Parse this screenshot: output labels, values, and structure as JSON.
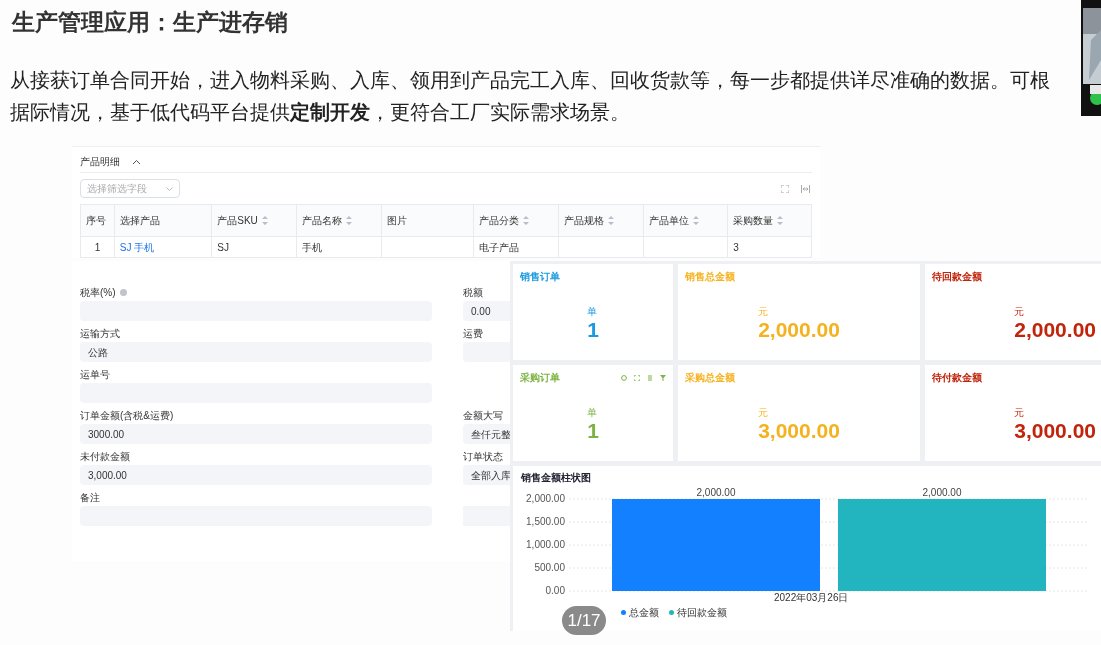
{
  "slide": {
    "title": "生产管理应用：生产进存销",
    "paragraph": "从接获订单合同开始，进入物料采购、入库、领用到产品完工入库、回收货款等，每一步都提供详尽准确的数据。可根据际情况，基于低代码平台提供**定制开发**，更符合工厂实际需求场景。",
    "counter": "1/17"
  },
  "product_section": {
    "title": "产品明细",
    "expanded": true,
    "filter_placeholder": "选择筛选字段",
    "columns": [
      {
        "label": "序号",
        "sortable": false
      },
      {
        "label": "选择产品",
        "sortable": false
      },
      {
        "label": "产品SKU",
        "sortable": true
      },
      {
        "label": "产品名称",
        "sortable": true
      },
      {
        "label": "图片",
        "sortable": false
      },
      {
        "label": "产品分类",
        "sortable": true
      },
      {
        "label": "产品规格",
        "sortable": true
      },
      {
        "label": "产品单位",
        "sortable": true
      },
      {
        "label": "采购数量",
        "sortable": true
      }
    ],
    "rows": [
      [
        "1",
        "SJ 手机",
        "SJ",
        "手机",
        "",
        "电子产品",
        "",
        "",
        "3"
      ]
    ]
  },
  "form": [
    {
      "left": {
        "label": "税率(%)",
        "info": true
      },
      "right": {
        "label": "税额",
        "value": "0.00"
      }
    },
    {
      "left": {
        "label": "运输方式",
        "info": false,
        "value": "公路"
      },
      "right": {
        "label": "运费"
      }
    },
    {
      "left": {
        "label": "运单号",
        "info": false
      }
    },
    {
      "left": {
        "label": "订单金额(含税&运费)",
        "info": false,
        "value": "3000.00"
      },
      "right": {
        "label": "金额大写",
        "value": "叁仟元整"
      }
    },
    {
      "left": {
        "label": "未付款金额",
        "info": false,
        "value": "3,000.00"
      },
      "right": {
        "label": "订单状态",
        "value": "全部入库"
      }
    },
    {
      "left": {
        "label": "备注",
        "info": false
      },
      "full": true
    }
  ],
  "stat_cards": [
    {
      "title": "销售订单",
      "unit": "单",
      "value": "1",
      "color": "#1a9be0",
      "toolbar": false
    },
    {
      "title": "销售总金额",
      "unit": "元",
      "value": "2,000.00",
      "color": "#f5b21f",
      "toolbar": false
    },
    {
      "title": "待回款金额",
      "unit": "元",
      "value": "2,000.00",
      "color": "#c0250c",
      "toolbar": false
    },
    {
      "title": "采购订单",
      "unit": "单",
      "value": "1",
      "color": "#7cb342",
      "toolbar": true
    },
    {
      "title": "采购总金额",
      "unit": "元",
      "value": "3,000.00",
      "color": "#f5b21f",
      "toolbar": false
    },
    {
      "title": "待付款金额",
      "unit": "元",
      "value": "3,000.00",
      "color": "#c0250c",
      "toolbar": false
    }
  ],
  "chart_card": {
    "chart_data": {
      "type": "bar",
      "title": "销售金额柱状图",
      "categories": [
        "2022年03月26日"
      ],
      "series": [
        {
          "name": "总金额",
          "color": "#1380ff",
          "values": [
            2000
          ]
        },
        {
          "name": "待回款金额",
          "color": "#22b5c0",
          "values": [
            2000
          ]
        }
      ],
      "ylim": [
        0,
        2000
      ],
      "yticks": [
        {
          "value": 0,
          "label": "0.00"
        },
        {
          "value": 500,
          "label": "500.00"
        },
        {
          "value": 1000,
          "label": "1,000.00"
        },
        {
          "value": 1500,
          "label": "1,500.00"
        },
        {
          "value": 2000,
          "label": "2,000.00"
        }
      ],
      "grid": true,
      "value_labels": [
        "2,000.00",
        "2,000.00"
      ]
    }
  }
}
